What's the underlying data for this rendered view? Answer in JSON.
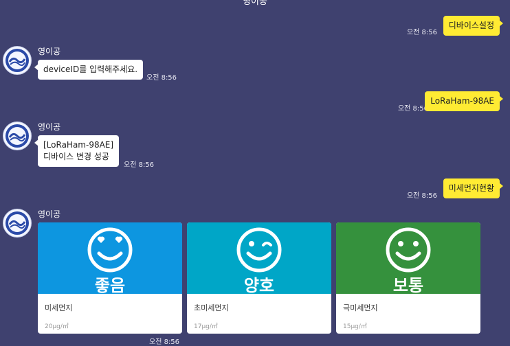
{
  "header": {
    "title": "영이공"
  },
  "messages": {
    "m1": {
      "text": "디바이스설정",
      "time": "오전 8:56"
    },
    "m2": {
      "sender": "영이공",
      "text": "deviceID를 입력해주세요.",
      "time": "오전 8:56"
    },
    "m3": {
      "text": "LoRaHam-98AE",
      "time": "오전 8:56"
    },
    "m4": {
      "sender": "영이공",
      "line1": "[LoRaHam-98AE]",
      "line2": "디바이스 변경 성공",
      "time": "오전 8:56"
    },
    "m5": {
      "text": "미세먼지현황",
      "time": "오전 8:56"
    },
    "m6": {
      "sender": "영이공",
      "time": "오전 8:56"
    }
  },
  "cards": [
    {
      "status": "좋음",
      "label": "미세먼지",
      "value": "20μg/㎥",
      "color": "#0d96e0",
      "icon": "heart-eyes-face-icon"
    },
    {
      "status": "양호",
      "label": "초미세먼지",
      "value": "17μg/㎥",
      "color": "#00a6c7",
      "icon": "winking-face-icon"
    },
    {
      "status": "보통",
      "label": "극미세먼지",
      "value": "15μg/㎥",
      "color": "#35913d",
      "icon": "smiling-face-icon"
    }
  ]
}
